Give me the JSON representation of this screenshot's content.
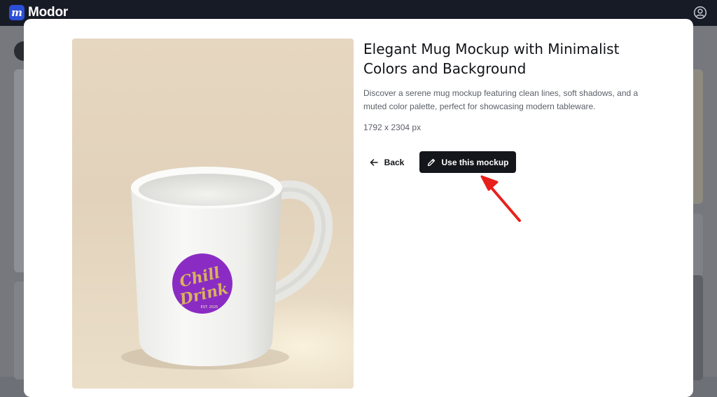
{
  "app": {
    "name": "Modor",
    "logo_letter": "m",
    "account_icon": "user-circle-icon"
  },
  "mockup": {
    "title": "Elegant Mug Mockup with Minimalist Colors and Background",
    "description": "Discover a serene mug mockup featuring clean lines, soft shadows, and a muted color palette, perfect for showcasing modern tableware.",
    "dimensions": "1792 x 2304 px",
    "preview_label": {
      "line1": "Chill",
      "line2": "Drink",
      "line3": "EST. 2025"
    }
  },
  "actions": {
    "back_label": "Back",
    "back_icon": "arrow-left-icon",
    "use_label": "Use this mockup",
    "use_icon": "pencil-icon"
  },
  "annotation": {
    "pointer": "red-arrow",
    "color": "#e8201c"
  },
  "colors": {
    "topbar": "#171b26",
    "brand": "#2c4fd8",
    "primary_button": "#14161c",
    "label_purple": "#8a2cc4",
    "label_gold": "#d9b35a"
  }
}
